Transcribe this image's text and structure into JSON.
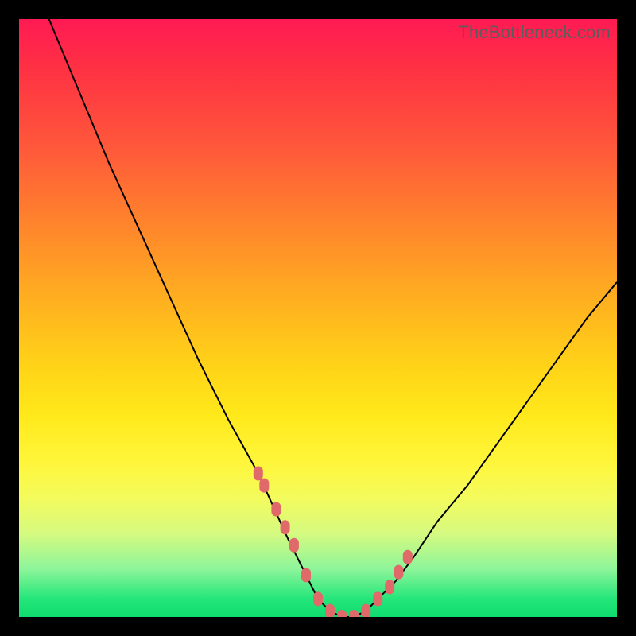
{
  "watermark": "TheBottleneck.com",
  "chart_data": {
    "type": "line",
    "title": "",
    "xlabel": "",
    "ylabel": "",
    "xlim": [
      0,
      100
    ],
    "ylim": [
      0,
      100
    ],
    "series": [
      {
        "name": "bottleneck-curve",
        "x": [
          5,
          10,
          15,
          20,
          25,
          30,
          35,
          40,
          45,
          48,
          50,
          52,
          54,
          56,
          58,
          60,
          63,
          66,
          70,
          75,
          80,
          85,
          90,
          95,
          100
        ],
        "values": [
          100,
          88,
          76,
          65,
          54,
          43,
          33,
          24,
          13,
          7,
          3,
          1,
          0,
          0,
          1,
          3,
          6,
          10,
          16,
          22,
          29,
          36,
          43,
          50,
          56
        ]
      }
    ],
    "markers": {
      "name": "highlighted-points",
      "color": "#e06a6a",
      "x": [
        40,
        41,
        43,
        44.5,
        46,
        48,
        50,
        52,
        54,
        56,
        58,
        60,
        62,
        63.5,
        65
      ],
      "values": [
        24,
        22,
        18,
        15,
        12,
        7,
        3,
        1,
        0,
        0,
        1,
        3,
        5,
        7.5,
        10
      ]
    }
  }
}
